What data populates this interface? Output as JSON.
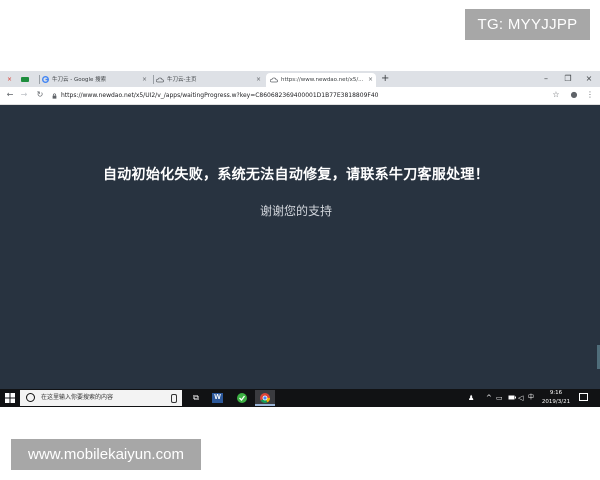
{
  "watermarks": {
    "top": "TG: MYYJJPP",
    "bottom": "www.mobilekaiyun.com"
  },
  "browser": {
    "tabs": [
      {
        "label": "牛刀云 - Google 搜索",
        "favicon": "google-g-icon"
      },
      {
        "label": "牛刀云-主页",
        "favicon": "cloud-icon"
      },
      {
        "label": "https://www.newdao.net/x5/...",
        "favicon": "cloud-icon",
        "active": true
      }
    ],
    "new_tab": "+",
    "window_buttons": {
      "minimize": "–",
      "maximize": "❐",
      "close": "×"
    },
    "tab_close": "×",
    "nav": {
      "back": "←",
      "forward": "→",
      "reload": "↻"
    },
    "url": "https://www.newdao.net/x5/UI2/v_/apps/waitingProgress.w?key=C860682369400001D1B77E3818809F40",
    "toolbar": {
      "bookmark": "☆",
      "profile": "●",
      "menu": "⋮"
    }
  },
  "page": {
    "headline": "自动初始化失败，系统无法自动修复，请联系牛刀客服处理！",
    "subtext": "谢谢您的支持"
  },
  "taskbar": {
    "search_placeholder": "在这里输入你要搜索的内容",
    "task_view": "⧉",
    "word_label": "W",
    "tray": {
      "people": "♟",
      "chevron": "^",
      "network": "▭",
      "volume": "◁",
      "ime": "中"
    },
    "time": "9:16",
    "date": "2019/3/21"
  },
  "colors": {
    "page_background": "#283340",
    "taskbar": "#111214",
    "tab_strip": "#dee1e6"
  }
}
